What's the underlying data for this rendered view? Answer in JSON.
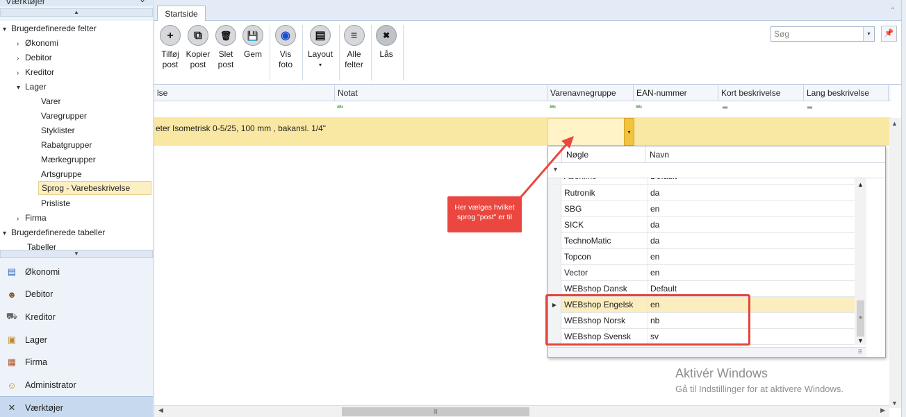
{
  "left_pane": {
    "top_cut_title": "Værktøjer",
    "tree": [
      {
        "label": "Brugerdefinerede felter",
        "level": 0,
        "toggle": "open"
      },
      {
        "label": "Økonomi",
        "level": 1,
        "toggle": "closed"
      },
      {
        "label": "Debitor",
        "level": 1,
        "toggle": "closed"
      },
      {
        "label": "Kreditor",
        "level": 1,
        "toggle": "closed"
      },
      {
        "label": "Lager",
        "level": 1,
        "toggle": "open"
      },
      {
        "label": "Varer",
        "level": 2,
        "toggle": "none"
      },
      {
        "label": "Varegrupper",
        "level": 2,
        "toggle": "none"
      },
      {
        "label": "Styklister",
        "level": 2,
        "toggle": "none"
      },
      {
        "label": "Rabatgrupper",
        "level": 2,
        "toggle": "none"
      },
      {
        "label": "Mærkegrupper",
        "level": 2,
        "toggle": "none"
      },
      {
        "label": "Artsgruppe",
        "level": 2,
        "toggle": "none"
      },
      {
        "label": "Sprog - Varebeskrivelse",
        "level": 2,
        "toggle": "none",
        "selected": true
      },
      {
        "label": "Prisliste",
        "level": 2,
        "toggle": "none"
      },
      {
        "label": "Firma",
        "level": 1,
        "toggle": "closed"
      },
      {
        "label": "Brugerdefinerede tabeller",
        "level": 0,
        "toggle": "open"
      },
      {
        "label": "Tabeller",
        "level": 1,
        "toggle": "none"
      }
    ],
    "nav": [
      {
        "label": "Økonomi",
        "icon": "ledger-icon"
      },
      {
        "label": "Debitor",
        "icon": "person-icon"
      },
      {
        "label": "Kreditor",
        "icon": "cart-icon"
      },
      {
        "label": "Lager",
        "icon": "box-icon"
      },
      {
        "label": "Firma",
        "icon": "building-icon"
      },
      {
        "label": "Administrator",
        "icon": "admin-icon"
      },
      {
        "label": "Værktøjer",
        "icon": "tools-icon",
        "selected": true
      }
    ]
  },
  "tabs": [
    {
      "label": "Startside"
    }
  ],
  "ribbon": {
    "buttons": [
      {
        "label1": "Tilføj",
        "label2": "post",
        "icon": "plus-icon",
        "glyph": "+"
      },
      {
        "label1": "Kopier",
        "label2": "post",
        "icon": "copy-icon",
        "glyph": "⧉"
      },
      {
        "label1": "Slet",
        "label2": "post",
        "icon": "trash-icon",
        "glyph": "🗑"
      },
      {
        "label1": "Gem",
        "label2": "",
        "icon": "save-icon",
        "glyph": "💾"
      },
      {
        "label1": "Vis",
        "label2": "foto",
        "icon": "eye-icon",
        "glyph": "◉"
      },
      {
        "label1": "Layout",
        "label2": "▾",
        "icon": "layout-icon",
        "glyph": "▤"
      },
      {
        "label1": "Alle",
        "label2": "felter",
        "icon": "list-icon",
        "glyph": "≡"
      },
      {
        "label1": "Lås",
        "label2": "",
        "icon": "lock-cloud-icon",
        "glyph": "✖"
      }
    ],
    "search_placeholder": "Søg"
  },
  "grid": {
    "columns": [
      "lse",
      "Notat",
      "Varenavnegruppe",
      "EAN-nummer",
      "Kort beskrivelse",
      "Lang beskrivelse"
    ],
    "active_row_text": "eter Isometrisk 0-5/25, 100 mm , bakansl. 1/4\"",
    "filter_abc": "ᴬᴮᶜ",
    "filter_eq": "═"
  },
  "popup": {
    "columns": [
      "Nøgle",
      "Navn"
    ],
    "partial_row": {
      "key": "Abonline",
      "name": "Default"
    },
    "rows": [
      {
        "key": "Rutronik",
        "name": "da"
      },
      {
        "key": "SBG",
        "name": "en"
      },
      {
        "key": "SICK",
        "name": "da"
      },
      {
        "key": "TechnoMatic",
        "name": "da"
      },
      {
        "key": "Topcon",
        "name": "en"
      },
      {
        "key": "Vector",
        "name": "en"
      },
      {
        "key": "WEBshop Dansk",
        "name": "Default"
      },
      {
        "key": "WEBshop Engelsk",
        "name": "en",
        "current": true
      },
      {
        "key": "WEBshop Norsk",
        "name": "nb"
      },
      {
        "key": "WEBshop Svensk",
        "name": "sv"
      }
    ]
  },
  "annotation": {
    "callout_text": "Her vælges hvilket sprog \"post\" er til",
    "color": "#e9473f"
  },
  "watermark": {
    "title": "Aktivér Windows",
    "subtitle": "Gå til Indstillinger for at aktivere Windows."
  }
}
